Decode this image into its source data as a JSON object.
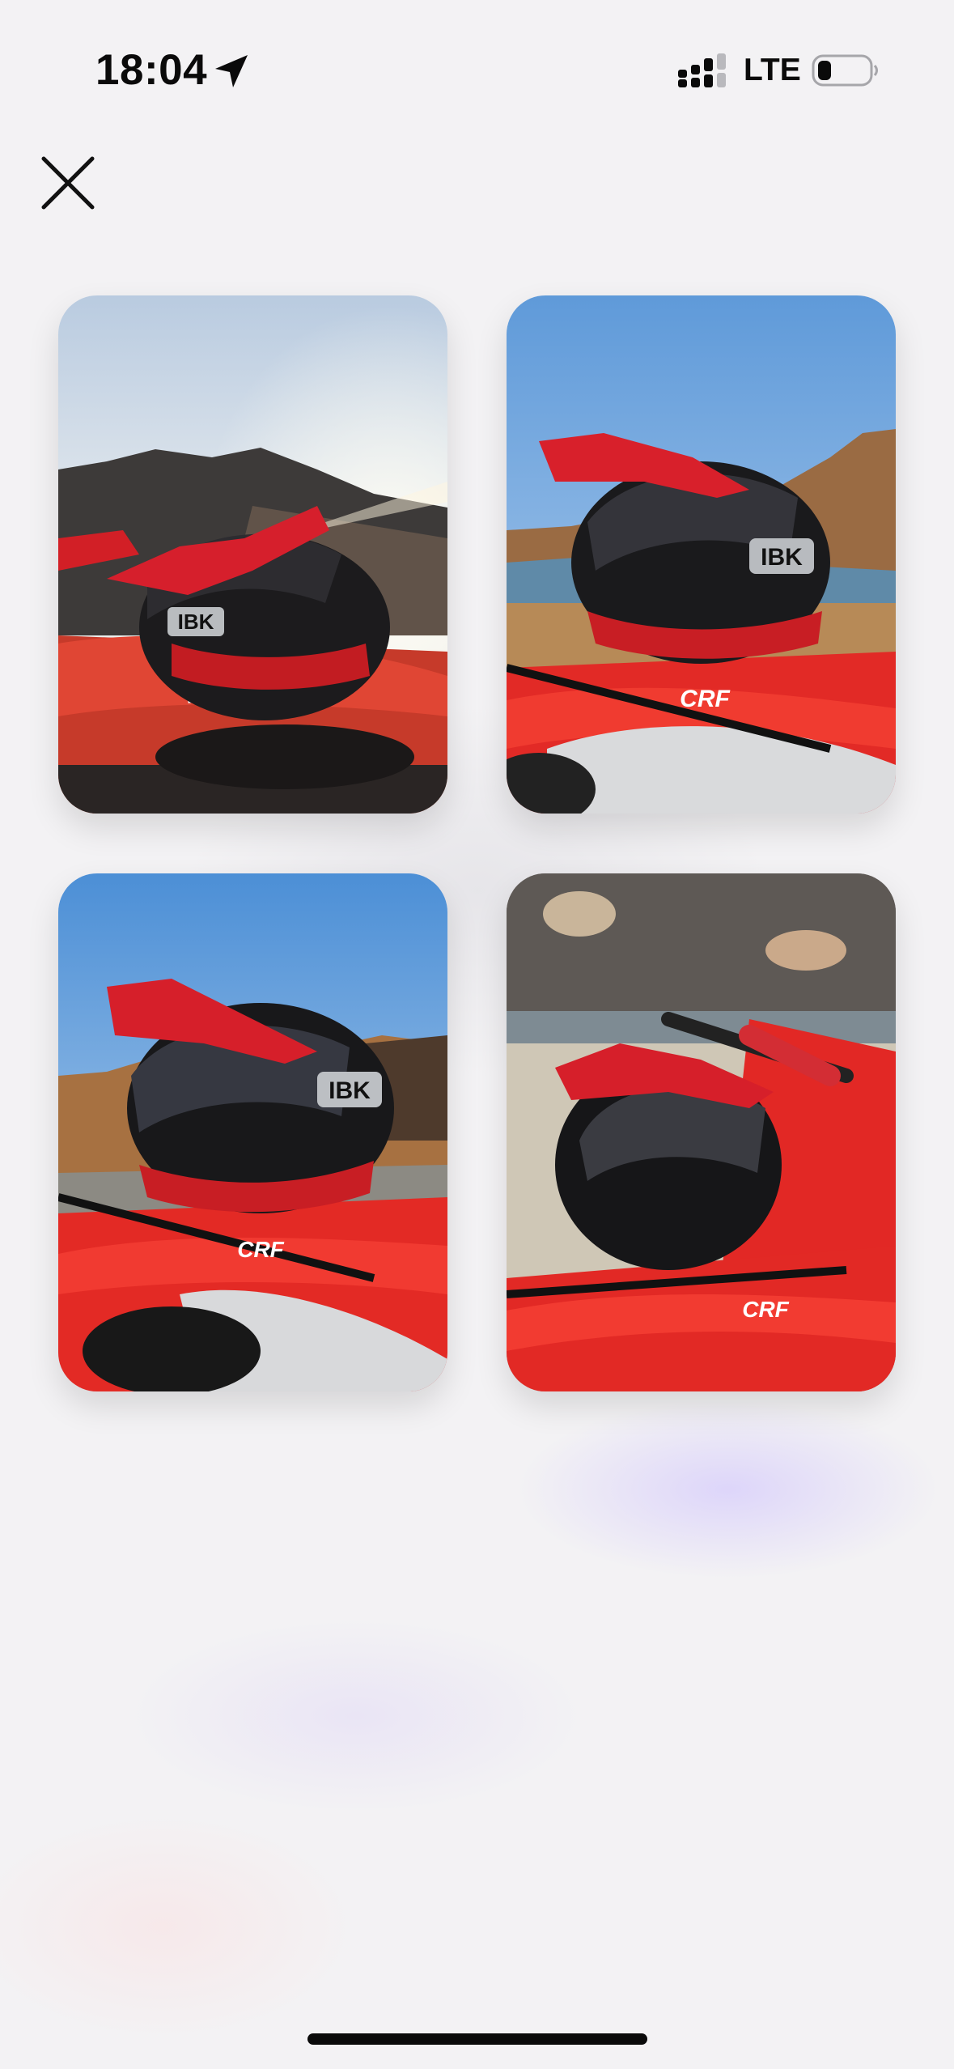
{
  "status_bar": {
    "time": "18:04",
    "network": "LTE",
    "location_icon": "location-arrow-icon",
    "signal_icon": "cellular-signal-icon",
    "battery_icon": "battery-icon"
  },
  "close_button": {
    "icon": "close-icon"
  },
  "photos": [
    {
      "alt": "Helmet on motorcycle seat at sunset",
      "logo_text": "IBK"
    },
    {
      "alt": "Helmet on motorcycle by lake",
      "logo_text": "IBK",
      "bike_text": "CRF"
    },
    {
      "alt": "Helmet on motorcycle under blue sky",
      "logo_text": "IBK",
      "bike_text": "CRF"
    },
    {
      "alt": "Helmet on motorcycle near handlebars",
      "bike_text": "CRF"
    }
  ],
  "colors": {
    "background": "#f3f2f4",
    "accent_red": "#e01b22",
    "text": "#0a0a0a"
  }
}
